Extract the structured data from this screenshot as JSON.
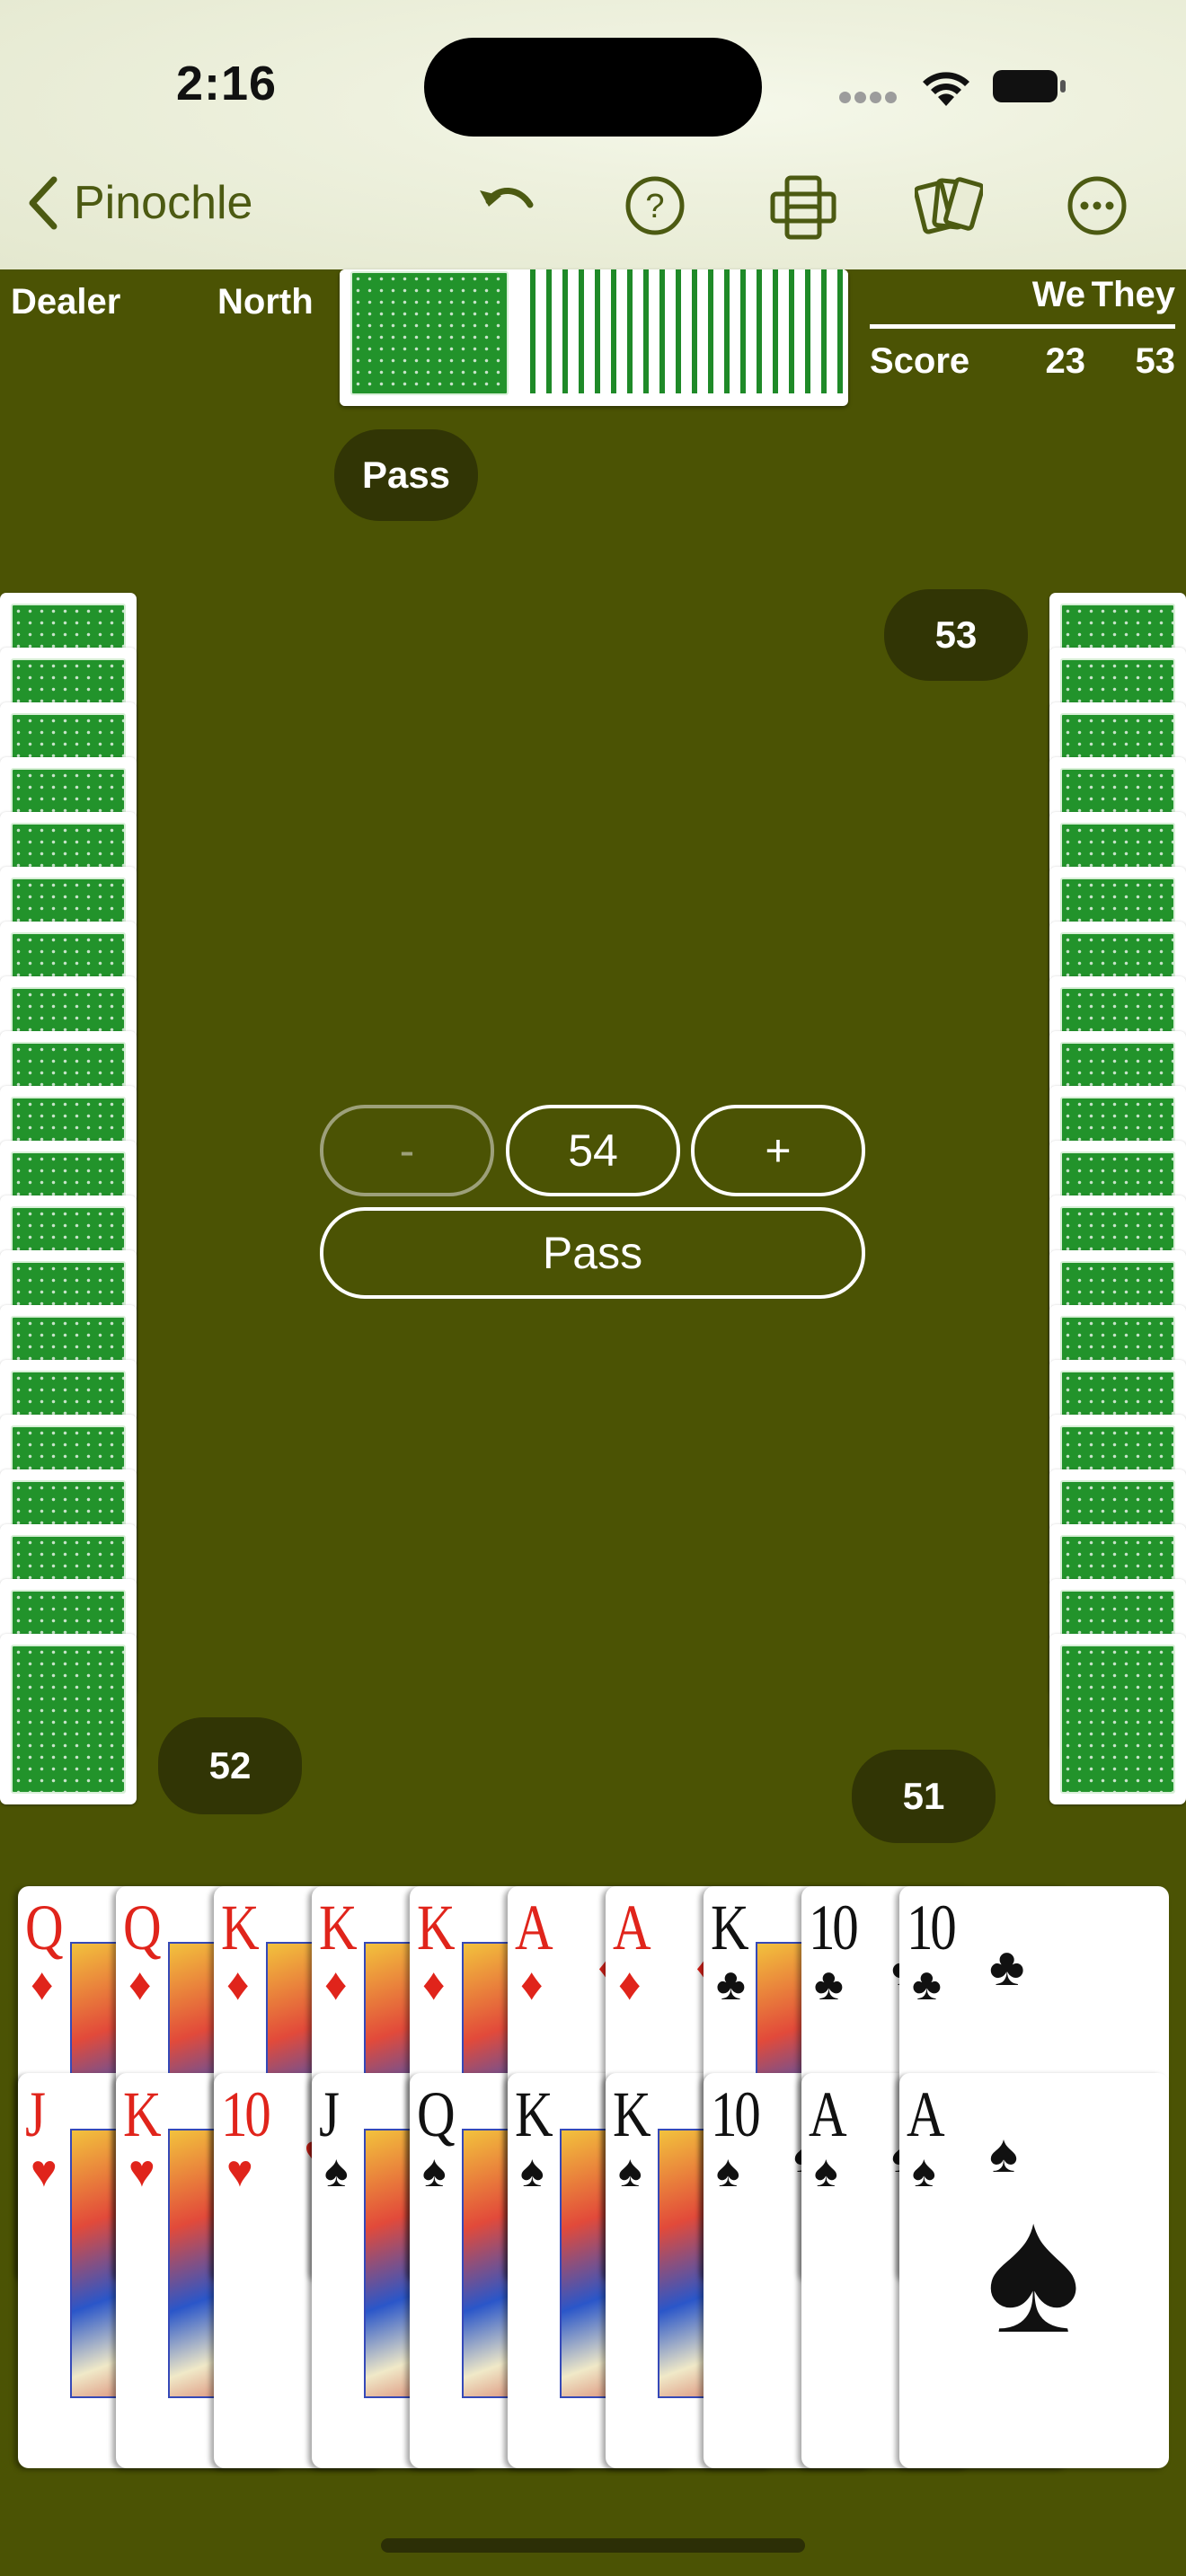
{
  "status_bar": {
    "time": "2:16"
  },
  "nav": {
    "back_label": "Pinochle",
    "icons": [
      "undo-icon",
      "help-icon",
      "arrange-cards-icon",
      "deck-icon",
      "more-icon"
    ]
  },
  "header": {
    "dealer_label": "Dealer",
    "north_label": "North"
  },
  "score": {
    "col_we": "We",
    "col_they": "They",
    "row_label": "Score",
    "we": "23",
    "they": "53"
  },
  "bids": {
    "north": "Pass",
    "east": "53",
    "west": "52",
    "south": "51"
  },
  "bid_controls": {
    "minus_label": "-",
    "value": "54",
    "plus_label": "+",
    "pass_label": "Pass"
  },
  "hand": {
    "top_row": [
      {
        "rank": "Q",
        "suit": "♦",
        "color": "red"
      },
      {
        "rank": "Q",
        "suit": "♦",
        "color": "red"
      },
      {
        "rank": "K",
        "suit": "♦",
        "color": "red"
      },
      {
        "rank": "K",
        "suit": "♦",
        "color": "red"
      },
      {
        "rank": "K",
        "suit": "♦",
        "color": "red"
      },
      {
        "rank": "A",
        "suit": "♦",
        "color": "red"
      },
      {
        "rank": "A",
        "suit": "♦",
        "color": "red"
      },
      {
        "rank": "K",
        "suit": "♣",
        "color": "black"
      },
      {
        "rank": "10",
        "suit": "♣",
        "color": "black"
      },
      {
        "rank": "10",
        "suit": "♣",
        "color": "black"
      }
    ],
    "bottom_row": [
      {
        "rank": "J",
        "suit": "♥",
        "color": "red"
      },
      {
        "rank": "K",
        "suit": "♥",
        "color": "red"
      },
      {
        "rank": "10",
        "suit": "♥",
        "color": "red"
      },
      {
        "rank": "J",
        "suit": "♠",
        "color": "black"
      },
      {
        "rank": "Q",
        "suit": "♠",
        "color": "black"
      },
      {
        "rank": "K",
        "suit": "♠",
        "color": "black"
      },
      {
        "rank": "K",
        "suit": "♠",
        "color": "black"
      },
      {
        "rank": "10",
        "suit": "♠",
        "color": "black"
      },
      {
        "rank": "A",
        "suit": "♠",
        "color": "black"
      },
      {
        "rank": "A",
        "suit": "♠",
        "color": "black"
      }
    ]
  },
  "colors": {
    "felt": "#4b5304",
    "pill": "#313505",
    "card_back": "#22932b",
    "nav_tint": "#4c5a12",
    "red_suit": "#e0241b"
  }
}
